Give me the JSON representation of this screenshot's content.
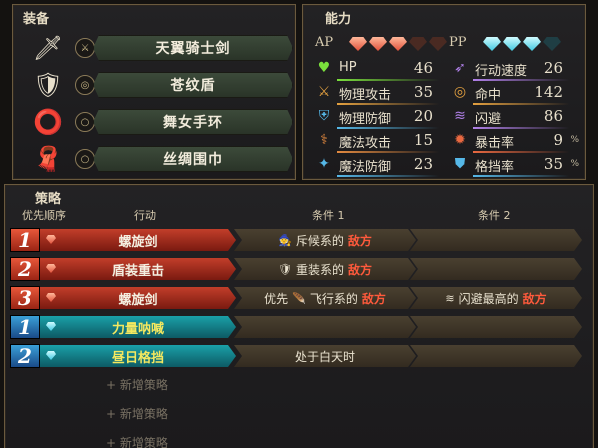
{
  "equipment": {
    "title": "装备",
    "items": [
      {
        "name": "天翼骑士剑",
        "icon": "sword-icon",
        "slot": "⚔"
      },
      {
        "name": "苍纹盾",
        "icon": "shield-icon",
        "slot": "◎"
      },
      {
        "name": "舞女手环",
        "icon": "bracelet-icon",
        "slot": "○"
      },
      {
        "name": "丝绸围巾",
        "icon": "scarf-icon",
        "slot": "○"
      }
    ]
  },
  "ability": {
    "title": "能力",
    "ap_label": "AP",
    "pp_label": "PP",
    "ap": {
      "filled": 3,
      "total": 5
    },
    "pp": {
      "filled": 3,
      "total": 4
    },
    "stats_left": [
      {
        "name": "HP",
        "value": "46",
        "icon": "heart-icon",
        "color": "#7adf3c"
      },
      {
        "name": "物理攻击",
        "value": "35",
        "icon": "sword-attack-icon",
        "color": "#e3a040"
      },
      {
        "name": "物理防御",
        "value": "20",
        "icon": "armor-icon",
        "color": "#56b8e8"
      },
      {
        "name": "魔法攻击",
        "value": "15",
        "icon": "staff-icon",
        "color": "#e38a40"
      },
      {
        "name": "魔法防御",
        "value": "23",
        "icon": "magic-defense-icon",
        "color": "#56b8e8"
      }
    ],
    "stats_right": [
      {
        "name": "行动速度",
        "value": "26",
        "icon": "speed-icon",
        "color": "#b080e8",
        "pct": ""
      },
      {
        "name": "命中",
        "value": "142",
        "icon": "target-icon",
        "color": "#e3a040",
        "pct": ""
      },
      {
        "name": "闪避",
        "value": "86",
        "icon": "evade-icon",
        "color": "#b080e8",
        "pct": ""
      },
      {
        "name": "暴击率",
        "value": "9",
        "icon": "critical-icon",
        "color": "#e86840",
        "pct": "%"
      },
      {
        "name": "格挡率",
        "value": "35",
        "icon": "block-icon",
        "color": "#56b8e8",
        "pct": "%"
      }
    ]
  },
  "strategy": {
    "title": "策略",
    "headers": {
      "priority": "优先顺序",
      "action": "行动",
      "cond1": "条件 1",
      "cond2": "条件 2"
    },
    "rows": [
      {
        "prio": "1",
        "type": "AP",
        "action": "螺旋剑",
        "cond1": {
          "icon": "🧙",
          "pre": "",
          "text": "斥候系的",
          "red": "敌方"
        },
        "cond2": null
      },
      {
        "prio": "2",
        "type": "AP",
        "action": "盾装重击",
        "cond1": {
          "icon": "🛡",
          "pre": "",
          "text": "重装系的",
          "red": "敌方"
        },
        "cond2": null
      },
      {
        "prio": "3",
        "type": "AP",
        "action": "螺旋剑",
        "cond1": {
          "icon": "🪶",
          "pre": "优先",
          "text": "飞行系的",
          "red": "敌方"
        },
        "cond2": {
          "icon": "≋",
          "text": "闪避最高的",
          "red": "敌方"
        }
      },
      {
        "prio": "1",
        "type": "PP",
        "action": "力量呐喊",
        "cond1": null,
        "cond2": null
      },
      {
        "prio": "2",
        "type": "PP",
        "action": "昼日格挡",
        "cond1": {
          "icon": "",
          "pre": "",
          "text": "处于白天时",
          "red": ""
        },
        "cond2": null
      }
    ],
    "add_label": "+ 新增策略",
    "add_count": 3
  }
}
